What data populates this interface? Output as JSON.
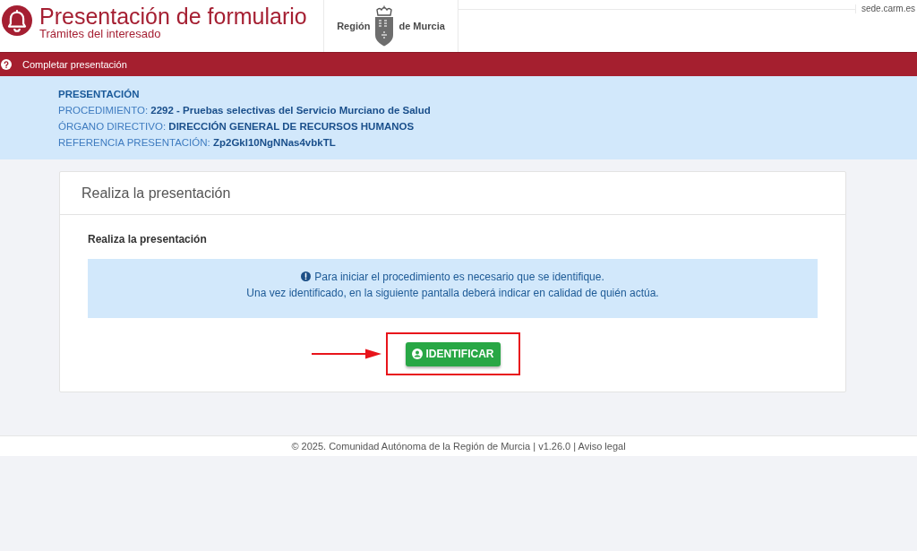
{
  "header": {
    "title": "Presentación de formulario",
    "subtitle": "Trámites del interesado",
    "logo": {
      "left_text": "Región",
      "right_text": "de Murcia"
    },
    "site": "sede.carm.es"
  },
  "action_bar": {
    "label": "Completar presentación"
  },
  "summary": {
    "heading": "PRESENTACIÓN",
    "fields": [
      {
        "label": "PROCEDIMIENTO:",
        "value": "2292 - Pruebas selectivas del Servicio Murciano de Salud"
      },
      {
        "label": "ÓRGANO DIRECTIVO:",
        "value": "DIRECCIÓN GENERAL DE RECURSOS HUMANOS"
      },
      {
        "label": "REFERENCIA PRESENTACIÓN:",
        "value": "Zp2Gkl10NgNNas4vbkTL"
      }
    ]
  },
  "card": {
    "title": "Realiza la presentación",
    "section_title": "Realiza la presentación",
    "alert": {
      "lines": [
        "Para iniciar el procedimiento es necesario que se identifique.",
        "Una vez identificado, en la siguiente pantalla deberá indicar en calidad de quién actúa."
      ]
    },
    "button": {
      "label": "IDENTIFICAR"
    }
  },
  "footer": {
    "text": "© 2025. Comunidad Autónoma de la Región de Murcia | v1.26.0 |",
    "link": "Aviso legal"
  }
}
